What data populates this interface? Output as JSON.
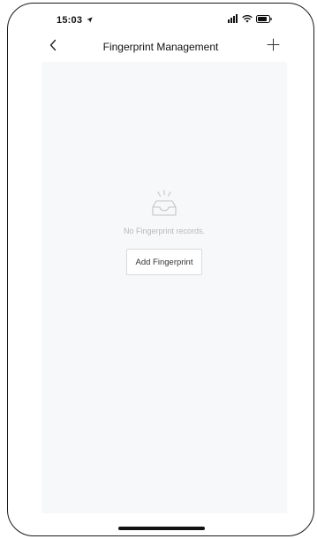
{
  "status_bar": {
    "time": "15:03",
    "location_icon": "location-arrow-icon",
    "signal_icon": "cellular-signal-icon",
    "wifi_icon": "wifi-icon",
    "battery_icon": "battery-icon"
  },
  "header": {
    "title": "Fingerprint Management",
    "back_icon": "chevron-left-icon",
    "add_icon": "plus-icon"
  },
  "empty_state": {
    "icon": "empty-inbox-icon",
    "message": "No Fingerprint records.",
    "button_label": "Add Fingerprint"
  },
  "colors": {
    "content_background": "#f7f8fa",
    "muted_text": "#b8b8b8",
    "button_border": "#d9d9d9"
  }
}
